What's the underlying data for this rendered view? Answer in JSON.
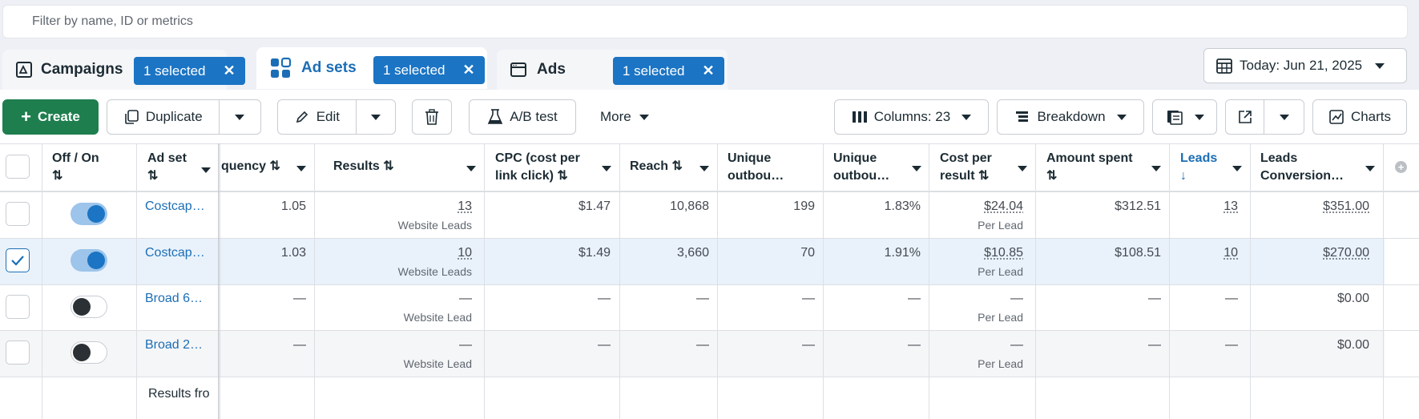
{
  "filter": {
    "placeholder": "Filter by name, ID or metrics"
  },
  "tabs": [
    {
      "label": "Campaigns",
      "badge": "1 selected"
    },
    {
      "label": "Ad sets",
      "badge": "1 selected"
    },
    {
      "label": "Ads",
      "badge": "1 selected"
    }
  ],
  "date_range": "Today: Jun 21, 2025",
  "toolbar": {
    "create": "Create",
    "duplicate": "Duplicate",
    "edit": "Edit",
    "ab_test": "A/B test",
    "more": "More",
    "columns": "Columns: 23",
    "breakdown": "Breakdown",
    "charts": "Charts"
  },
  "columns": {
    "off_on": "Off / On",
    "ad_set": "Ad set",
    "frequency": "quency",
    "results": "Results",
    "cpc_1": "CPC (cost per",
    "cpc_2": "link click)",
    "reach": "Reach",
    "unique_1": "Unique",
    "unique_2": "outbou…",
    "unique_ctr_1": "Unique",
    "unique_ctr_2": "outbou…",
    "cost_1": "Cost per",
    "cost_2": "result",
    "amount": "Amount spent",
    "leads": "Leads",
    "leads_conv_1": "Leads",
    "leads_conv_2": "Conversion…"
  },
  "rows": [
    {
      "name": "Costcap…",
      "on": true,
      "checked": false,
      "frequency": "1.05",
      "results": "13",
      "results_sub": "Website Leads",
      "cpc": "$1.47",
      "reach": "10,868",
      "unique_clicks": "199",
      "unique_ctr": "1.83%",
      "cost": "$24.04",
      "cost_sub": "Per Lead",
      "amount": "$312.51",
      "leads": "13",
      "leads_value": "$351.00"
    },
    {
      "name": "Costcap…",
      "on": true,
      "checked": true,
      "frequency": "1.03",
      "results": "10",
      "results_sub": "Website Leads",
      "cpc": "$1.49",
      "reach": "3,660",
      "unique_clicks": "70",
      "unique_ctr": "1.91%",
      "cost": "$10.85",
      "cost_sub": "Per Lead",
      "amount": "$108.51",
      "leads": "10",
      "leads_value": "$270.00"
    },
    {
      "name": "Broad 6…",
      "on": false,
      "checked": false,
      "frequency": "—",
      "results": "—",
      "results_sub": "Website Lead",
      "cpc": "—",
      "reach": "—",
      "unique_clicks": "—",
      "unique_ctr": "—",
      "cost": "—",
      "cost_sub": "Per Lead",
      "amount": "—",
      "leads": "—",
      "leads_value": "$0.00"
    },
    {
      "name": "Broad 2…",
      "on": false,
      "checked": false,
      "frequency": "—",
      "results": "—",
      "results_sub": "Website Lead",
      "cpc": "—",
      "reach": "—",
      "unique_clicks": "—",
      "unique_ctr": "—",
      "cost": "—",
      "cost_sub": "Per Lead",
      "amount": "—",
      "leads": "—",
      "leads_value": "$0.00"
    }
  ],
  "footer": {
    "results_from": "Results fro"
  },
  "colors": {
    "accent": "#1b74c4",
    "create": "#1e7e4e",
    "toggle_on": "#1b74c4",
    "toggle_off": "#2b3035"
  },
  "icons": [
    "campaign-icon",
    "adsets-icon",
    "ads-icon",
    "calendar-icon",
    "plus-icon",
    "duplicate-icon",
    "pencil-icon",
    "trash-icon",
    "flask-icon",
    "columns-icon",
    "breakdown-icon",
    "reports-icon",
    "export-icon",
    "chart-icon",
    "sort-icon",
    "checkmark-icon",
    "add-column-icon"
  ]
}
